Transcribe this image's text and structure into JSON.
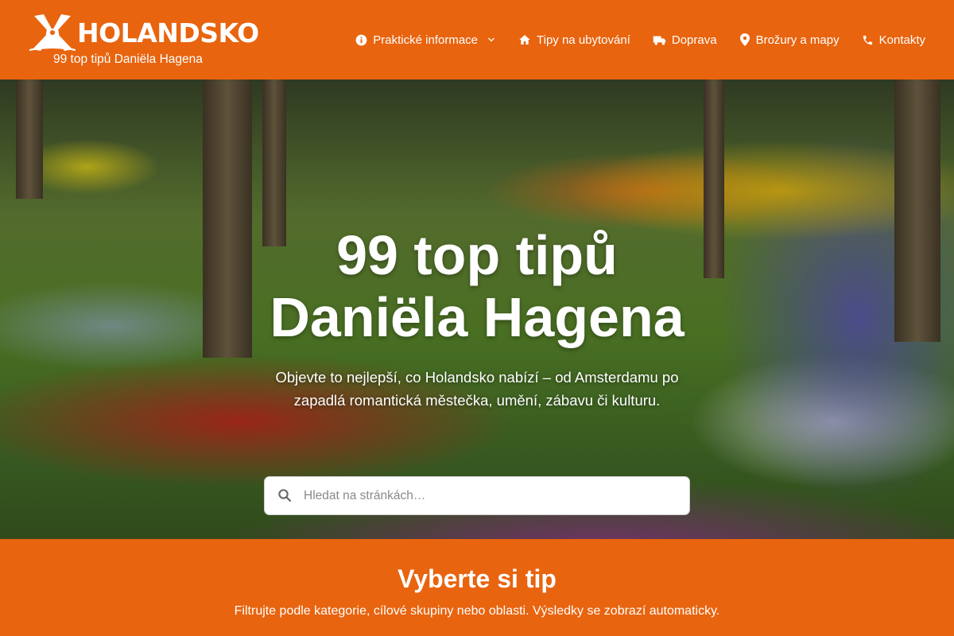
{
  "header": {
    "logo": {
      "wordmark": "HOLANDSKO",
      "tagline": "99 top tipů Daniëla Hagena"
    },
    "nav": [
      {
        "label": "Praktické informace",
        "icon": "info-icon"
      },
      {
        "label": "Tipy na ubytování",
        "icon": "home-icon"
      },
      {
        "label": "Doprava",
        "icon": "truck-icon"
      },
      {
        "label": "Brožury a mapy",
        "icon": "map-pin-icon"
      },
      {
        "label": "Kontakty",
        "icon": "phone-icon"
      }
    ],
    "dropdown_icon": "chevron-down-icon"
  },
  "hero": {
    "title_line1": "99 top tipů",
    "title_line2": "Daniëla Hagena",
    "subtitle_line1": "Objevte to nejlepší, co Holandsko nabízí – od Amsterdamu po",
    "subtitle_line2": "zapadlá romantická městečka, umění, zábavu či kulturu.",
    "search": {
      "placeholder": "Hledat na stránkách…",
      "value": "",
      "icon": "search-icon"
    }
  },
  "tips_section": {
    "title": "Vyberte si tip",
    "subtitle": "Filtrujte podle kategorie, cílové skupiny nebo oblasti. Výsledky se zobrazí automaticky."
  },
  "colors": {
    "brand_orange": "#e8640f",
    "text_white": "#ffffff"
  }
}
